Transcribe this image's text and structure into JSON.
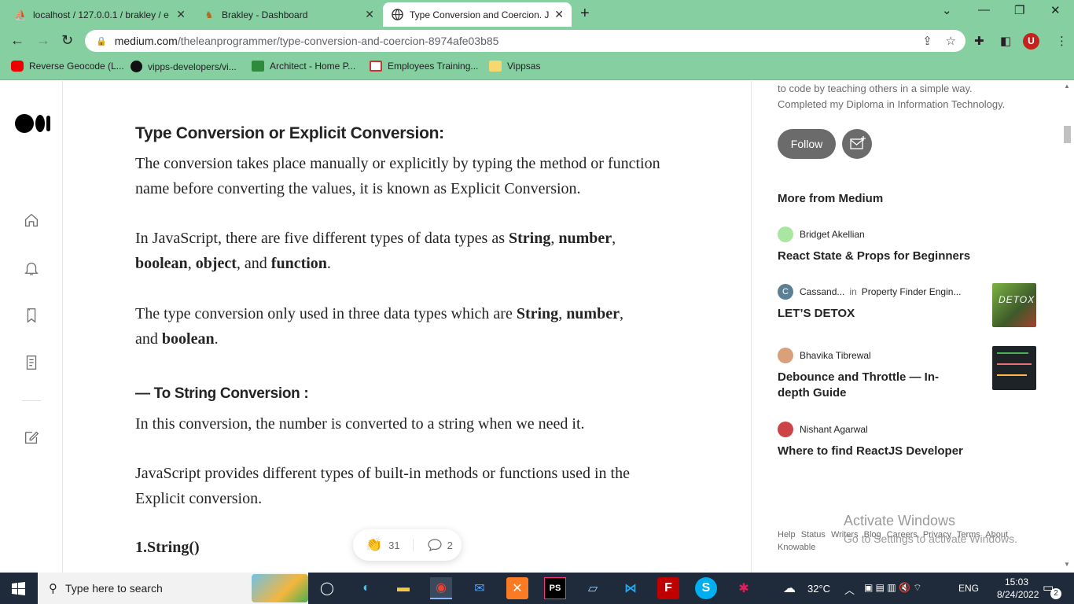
{
  "browser": {
    "tabs": [
      {
        "label": "localhost / 127.0.0.1 / brakley / e",
        "favicon": "phpmyadmin-icon"
      },
      {
        "label": "Brakley - Dashboard",
        "favicon": "brakley-icon"
      },
      {
        "label": "Type Conversion and Coercion. Ja",
        "favicon": "globe-icon",
        "active": true
      }
    ],
    "url_host": "medium.com",
    "url_path": "/theleanprogrammer/type-conversion-and-coercion-8974afe03b85",
    "profile_initial": "U",
    "theme_color": "#86cfa0",
    "bookmarks": [
      {
        "label": "Reverse Geocode (L...",
        "icon": "youtube-icon"
      },
      {
        "label": "vipps-developers/vi...",
        "icon": "github-icon"
      },
      {
        "label": "Architect - Home P...",
        "icon": "architect-icon"
      },
      {
        "label": "Employees Training...",
        "icon": "sg-icon"
      },
      {
        "label": "Vippsas",
        "icon": "folder-icon"
      }
    ]
  },
  "article": {
    "heading1": "Type Conversion or Explicit Conversion:",
    "p1": "The conversion takes place manually or explicitly by typing the method or function name before converting the values, it is known as Explicit Conversion.",
    "p2_pre": "In JavaScript, there are five different types of data types as ",
    "p2_b1": "String",
    "p2_s1": ", ",
    "p2_b2": "number",
    "p2_s2": ",",
    "p2_b3": "boolean",
    "p2_s3": ", ",
    "p2_b4": "object",
    "p2_s4": ", and ",
    "p2_b5": "function",
    "p2_s5": ".",
    "p3_pre": "The type conversion only used in three data types which are ",
    "p3_b1": "String",
    "p3_s1": ", ",
    "p3_b2": "number",
    "p3_s2": ",",
    "p3_s3": "and ",
    "p3_b3": "boolean",
    "p3_s4": ".",
    "heading2": "— To String Conversion :",
    "p4": "In this conversion, the number is converted to a string when we need it.",
    "p5": "JavaScript provides different types of built-in methods or functions used in the Explicit conversion.",
    "heading3": "1.String()",
    "claps": "31",
    "responses": "2"
  },
  "sidebar": {
    "bio_line1": "to code by teaching others in a simple way.",
    "bio_line2": "Completed my Diploma in Information Technology.",
    "follow_label": "Follow",
    "more_title": "More from Medium",
    "stories": [
      {
        "author": "Bridget Akellian",
        "publication": "",
        "in": "",
        "title": "React State & Props for Beginners",
        "avatar_color": "#a8e6a1",
        "thumb": ""
      },
      {
        "author": "Cassand...",
        "in": "in",
        "publication": "Property Finder Engin...",
        "title": "LET’S DETOX",
        "avatar_color": "#5b7f95",
        "avatar_letter": "C",
        "thumb": "detox"
      },
      {
        "author": "Bhavika Tibrewal",
        "publication": "",
        "in": "",
        "title": "Debounce and Throttle — In-depth Guide",
        "avatar_color": "#d9a07a",
        "thumb": "dark"
      },
      {
        "author": "Nishant Agarwal",
        "publication": "",
        "in": "",
        "title": "Where to find ReactJS Developer",
        "avatar_color": "#c44",
        "thumb": ""
      }
    ],
    "thumb_text": "DETOX",
    "footer_links": [
      "Help",
      "Status",
      "Writers",
      "Blog",
      "Careers",
      "Privacy",
      "Terms",
      "About",
      "Knowable"
    ]
  },
  "watermark": {
    "line1": "Activate Windows",
    "line2": "Go to Settings to activate Windows."
  },
  "taskbar": {
    "search_placeholder": "Type here to search",
    "temperature": "32°C",
    "language": "ENG",
    "time": "15:03",
    "date": "8/24/2022",
    "notifications": "2"
  }
}
